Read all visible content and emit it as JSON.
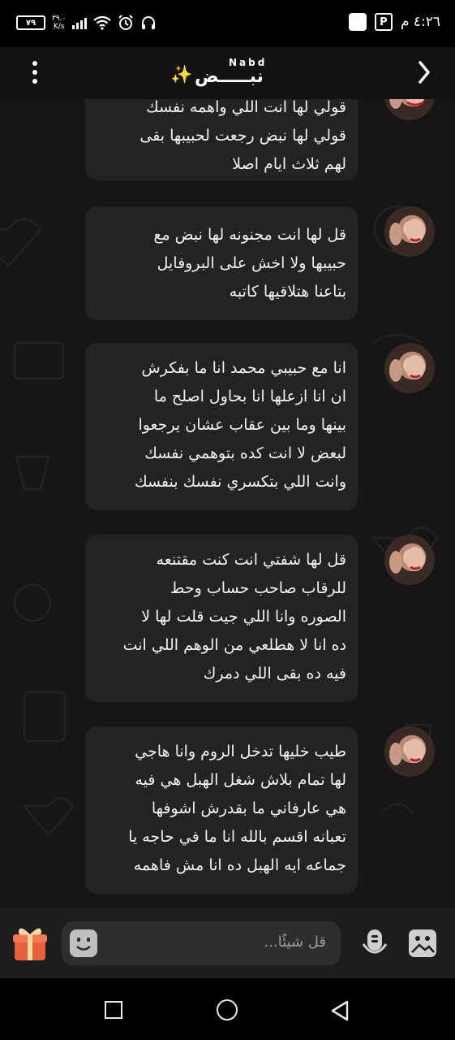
{
  "status_bar": {
    "battery": "٧٩",
    "net_speed_value": "٣٩.٠",
    "net_speed_unit": "K/s",
    "time": "٤:٢٦ م"
  },
  "header": {
    "title_latin": "Nabd",
    "title_arabic": "نبـــــض",
    "title_emoji": "✨"
  },
  "messages": [
    {
      "text": "قولي لها انت اللي واهمه نفسك\nقولي لها نبض رجعت لحبيبها بقى\nلهم ثلاث ايام اصلا"
    },
    {
      "text": "قل لها انت مجنونه لها نبض مع\nحبيبها ولا اخش على البروفايل\nبتاعنا هتلاقيها كاتبه"
    },
    {
      "text": "انا مع حبيبي محمد انا ما بفكرش\nان انا ازعلها انا بحاول اصلح ما\nبينها وما بين عقاب عشان يرجعوا\nلبعض لا انت كده بتوهمي نفسك\nوانت اللي بتكسري نفسك بنفسك"
    },
    {
      "text": "قل لها شفتي انت كنت مقتنعه\nللرقاب صاحب حساب وحط\nالصوره وانا اللي جيت قلت لها لا\nده انا لا هطلعي من الوهم اللي انت\nفيه ده بقى اللي دمرك"
    },
    {
      "text": "طيب خليها تدخل الروم وانا هاجي\nلها تمام بلاش شغل الهبل هي فيه\nهي عارفاني ما بقدرش اشوفها\nتعبانه اقسم بالله انا ما في حاجه يا\nجماعه ايه الهبل ده انا مش فاهمه"
    }
  ],
  "input": {
    "placeholder": "قل شيئًا..."
  },
  "colors": {
    "background": "#161616",
    "bubble": "#232323",
    "header": "#121212",
    "accent_spark": "#f5c518",
    "gift": "#e8603c"
  }
}
